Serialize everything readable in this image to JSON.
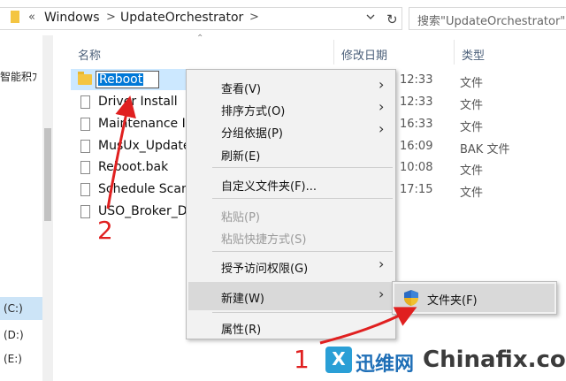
{
  "address": {
    "breadcrumb_prefix": "«",
    "crumbs": [
      "Windows",
      "UpdateOrchestrator"
    ],
    "separator": ">",
    "refresh_glyph": "↻",
    "search_placeholder": "搜索\"UpdateOrchestrator\""
  },
  "nav": {
    "quick_access_partial": "智能积ﾌ",
    "drives": [
      "(C:)",
      "(D:)",
      "(E:)"
    ]
  },
  "columns": {
    "name": "名称",
    "modified": "修改日期",
    "type": "类型"
  },
  "files": [
    {
      "name": "Reboot",
      "time": "12:33",
      "type": "文件",
      "kind": "folder",
      "renaming": true
    },
    {
      "name": "Driver Install",
      "time": "12:33",
      "type": "文件",
      "kind": "file"
    },
    {
      "name": "Maintenance In",
      "time": "16:33",
      "type": "文件",
      "kind": "file"
    },
    {
      "name": "MusUx_Update",
      "time": "16:09",
      "type": "BAK 文件",
      "kind": "file"
    },
    {
      "name": "Reboot.bak",
      "time": "10:08",
      "type": "文件",
      "kind": "file"
    },
    {
      "name": "Schedule Scan",
      "time": "17:15",
      "type": "文件",
      "kind": "file"
    },
    {
      "name": "USO_Broker_Di",
      "time": "",
      "type": "",
      "kind": "file"
    }
  ],
  "context_menu": {
    "items": [
      {
        "label": "查看(V)",
        "submenu": true,
        "disabled": false
      },
      {
        "label": "排序方式(O)",
        "submenu": true,
        "disabled": false
      },
      {
        "label": "分组依据(P)",
        "submenu": true,
        "disabled": false
      },
      {
        "label": "刷新(E)",
        "submenu": false,
        "disabled": false
      },
      {
        "label": "自定义文件夹(F)...",
        "submenu": false,
        "disabled": false
      },
      {
        "label": "粘贴(P)",
        "submenu": false,
        "disabled": true
      },
      {
        "label": "粘贴快捷方式(S)",
        "submenu": false,
        "disabled": true
      },
      {
        "label": "授予访问权限(G)",
        "submenu": true,
        "disabled": false
      },
      {
        "label": "新建(W)",
        "submenu": true,
        "disabled": false,
        "highlighted": true
      },
      {
        "label": "属性(R)",
        "submenu": false,
        "disabled": false
      }
    ],
    "arrow_glyph": "›"
  },
  "submenu_new": {
    "items": [
      {
        "label": "文件夹(F)",
        "icon": "shield-folder-icon"
      }
    ]
  },
  "annotations": {
    "step1": "1",
    "step2": "2",
    "color": "#e02020"
  },
  "watermark": {
    "logo_letter": "X",
    "brand_cn": "迅维网",
    "brand_en": "Chinafix.com"
  }
}
